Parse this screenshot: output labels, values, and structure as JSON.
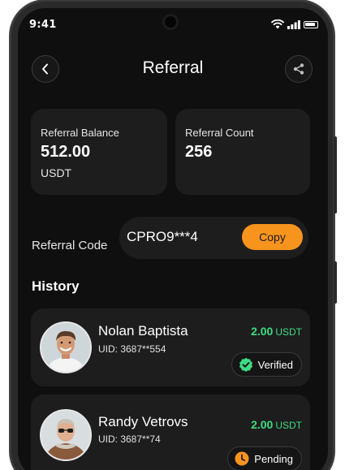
{
  "status_bar": {
    "time": "9:41"
  },
  "header": {
    "title": "Referral"
  },
  "balance_card": {
    "label": "Referral Balance",
    "value": "512.00",
    "unit": "USDT"
  },
  "count_card": {
    "label": "Referral Count",
    "value": "256"
  },
  "referral_code": {
    "label": "Referral Code",
    "code": "CPRO9***4",
    "copy_label": "Copy"
  },
  "history": {
    "title": "History",
    "items": [
      {
        "name": "Nolan Baptista",
        "uid": "UID: 3687**554",
        "amount": "2.00",
        "unit": "USDT",
        "status": "Verified",
        "status_color": "#3ddc84"
      },
      {
        "name": "Randy Vetrovs",
        "uid": "UID: 3687**74",
        "amount": "2.00",
        "unit": "USDT",
        "status": "Pending",
        "status_color": "#f7941d"
      }
    ]
  },
  "colors": {
    "accent": "#f7941d",
    "positive": "#3ddc84",
    "background": "#0f0f0f",
    "card": "#1d1d1d"
  }
}
